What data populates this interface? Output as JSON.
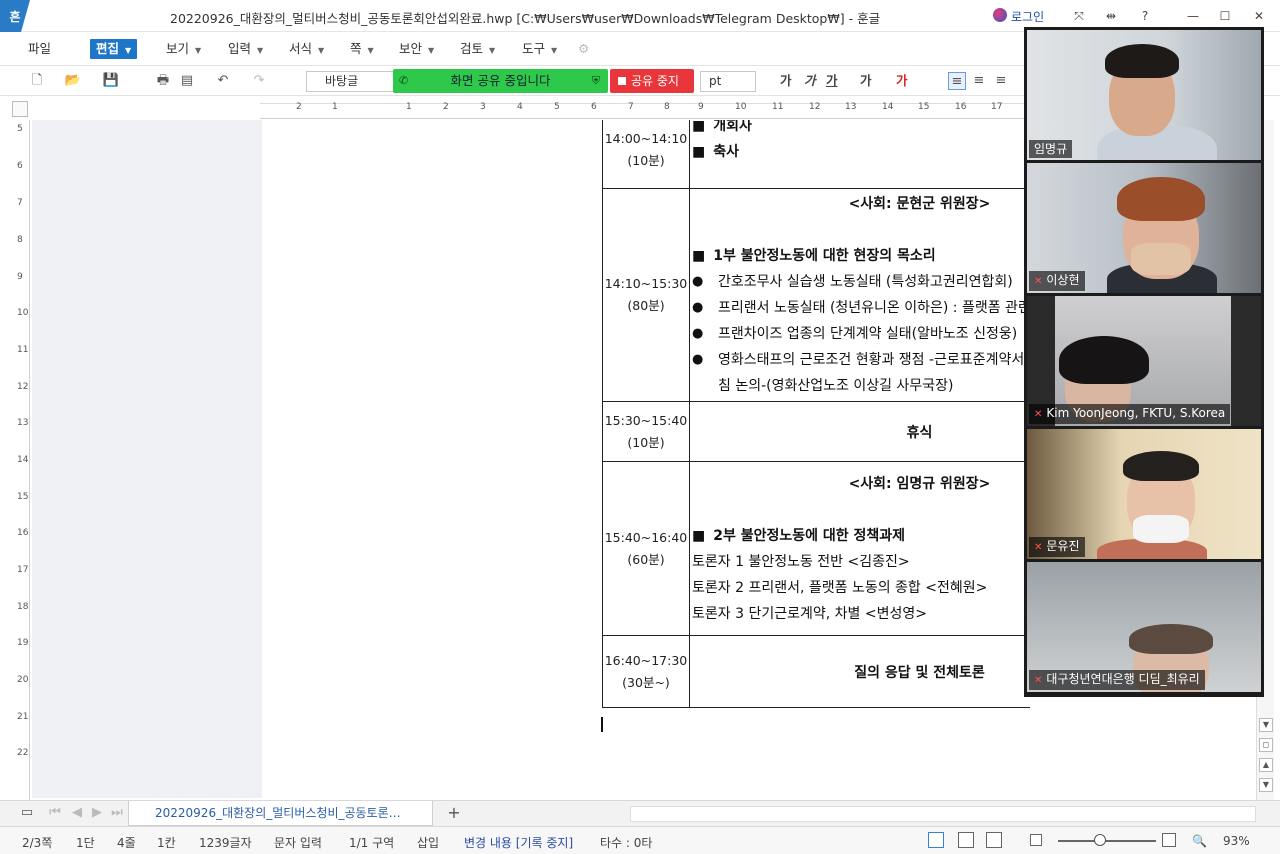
{
  "window": {
    "app_logo": "흔",
    "title": "20220926_대환장의_멀티버스청비_공동토론회안섭외완료.hwp [C:₩Users₩user₩Downloads₩Telegram Desktop₩] - 훈글",
    "login_label": "로그인",
    "buttons": [
      "⤧",
      "⇹",
      "?",
      "—",
      "☐",
      "✕"
    ]
  },
  "menu": {
    "file": "파일",
    "items": [
      "편집",
      "보기",
      "입력",
      "서식",
      "쪽",
      "보안",
      "검토",
      "도구"
    ]
  },
  "toolbar": {
    "style_value": "바탕글",
    "share_banner": "화면 공유 중입니다",
    "stop_share": "공유 중지",
    "unit_value": "pt",
    "format_buttons": [
      "가",
      "가",
      "가",
      "가",
      "가"
    ]
  },
  "ruler": {
    "h_ticks": [
      "2",
      "1",
      "1",
      "2",
      "3",
      "4",
      "5",
      "6",
      "7",
      "8",
      "9",
      "10",
      "11",
      "12",
      "13",
      "14",
      "15",
      "16",
      "17"
    ],
    "v_ticks": [
      "5",
      "6",
      "7",
      "8",
      "9",
      "10",
      "11",
      "12",
      "13",
      "14",
      "15",
      "16",
      "17",
      "18",
      "19",
      "20",
      "21",
      "22"
    ]
  },
  "schedule": {
    "rows": [
      {
        "time": "14:00~14:10",
        "duration": "(10분)",
        "items": [
          "개회사",
          "축사"
        ]
      },
      {
        "time": "14:10~15:30",
        "duration": "(80분)",
        "host": "<사회: 문현군 위원장>",
        "section": "1부 불안정노동에 대한 현장의 목소리",
        "bullets": [
          "간호조무사 실습생 노동실태 (특성화고권리연합회)",
          "프리랜서 노동실태 (청년유니온 이하은) : 플랫폼 관련",
          "프랜차이즈 업종의 단계계약 실태(알바노조 신정웅)",
          "영화스태프의 근로조건 현황과 쟁점 -근로표준계약서 도입과 표준 보수지침 논의-(영화산업노조 이상길 사무국장)"
        ]
      },
      {
        "time": "15:30~15:40",
        "duration": "(10분)",
        "title": "휴식"
      },
      {
        "time": "15:40~16:40",
        "duration": "(60분)",
        "host": "<사회: 임명규 위원장>",
        "section": "2부 불안정노동에 대한 정책과제",
        "lines": [
          "토론자 1 불안정노동 전반 <김종진>",
          "토론자 2 프리랜서, 플랫폼 노동의 종합 <전혜원>",
          "토론자 3 단기근로계약, 차별 <변성영>"
        ]
      },
      {
        "time": "16:40~17:30",
        "duration": "(30분~)",
        "title": "질의 응답 및 전체토론"
      }
    ]
  },
  "video_call": {
    "participants": [
      {
        "name": "임명규",
        "muted": false,
        "active": true
      },
      {
        "name": "이상현",
        "muted": true,
        "active": false
      },
      {
        "name": "Kim YoonJeong, FKTU, S.Korea",
        "muted": true,
        "active": false
      },
      {
        "name": "문유진",
        "muted": true,
        "active": false
      },
      {
        "name": "대구청년연대은행 디딤_최유리",
        "muted": true,
        "active": false
      }
    ]
  },
  "tabs": {
    "doc_tab": "20220926_대환장의_멀티버스청비_공동토론…",
    "add": "+"
  },
  "status": {
    "page": "2/3쪽",
    "column": "1단",
    "line": "4줄",
    "col": "1칸",
    "chars": "1239글자",
    "mode": "문자 입력",
    "section": "1/1 구역",
    "insert": "삽입",
    "track": "변경 내용 [기록 중지]",
    "typing": "타수 : 0타",
    "zoom": "93%"
  },
  "colors": {
    "accent": "#1f76c8",
    "share_green": "#2ec84a",
    "stop_red": "#e8363a",
    "active_speaker": "#5ec65a"
  }
}
